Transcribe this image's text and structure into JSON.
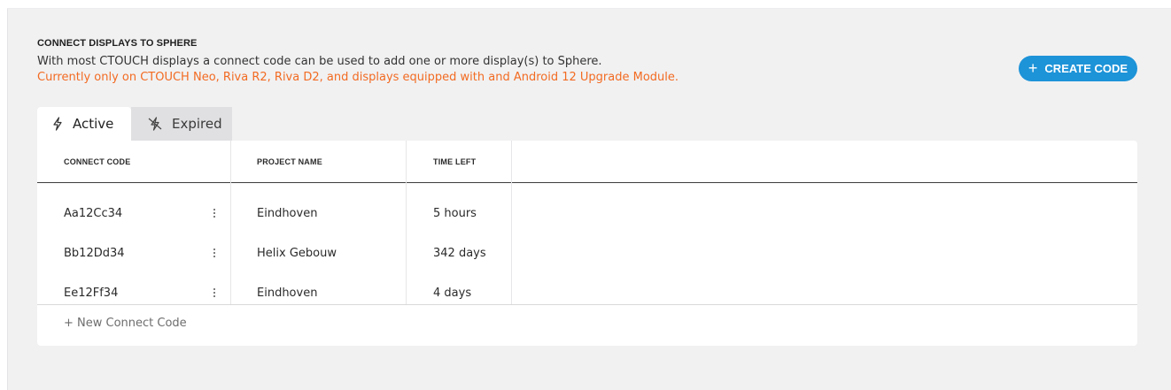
{
  "section": {
    "title": "CONNECT DISPLAYS TO SPHERE",
    "description": "With most CTOUCH displays a connect code can be used to add one or more display(s) to Sphere.",
    "note": "Currently only on CTOUCH Neo, Riva R2, Riva D2, and displays equipped with and Android 12 Upgrade Module.",
    "note_color": "#f26b22"
  },
  "create_button": {
    "plus": "+",
    "label": "CREATE CODE",
    "color": "#1d93d8"
  },
  "tabs": [
    {
      "label": "Active",
      "icon": "bolt-icon",
      "selected": true
    },
    {
      "label": "Expired",
      "icon": "bolt-off-icon",
      "selected": false
    }
  ],
  "table": {
    "columns": [
      "CONNECT CODE",
      "PROJECT NAME",
      "TIME LEFT"
    ],
    "rows": [
      {
        "code": "Aa12Cc34",
        "project": "Eindhoven",
        "time_left": "5 hours"
      },
      {
        "code": "Bb12Dd34",
        "project": "Helix Gebouw",
        "time_left": "342 days"
      },
      {
        "code": "Ee12Ff34",
        "project": "Eindhoven",
        "time_left": "4 days"
      }
    ],
    "new_code_label": "+ New Connect Code"
  }
}
